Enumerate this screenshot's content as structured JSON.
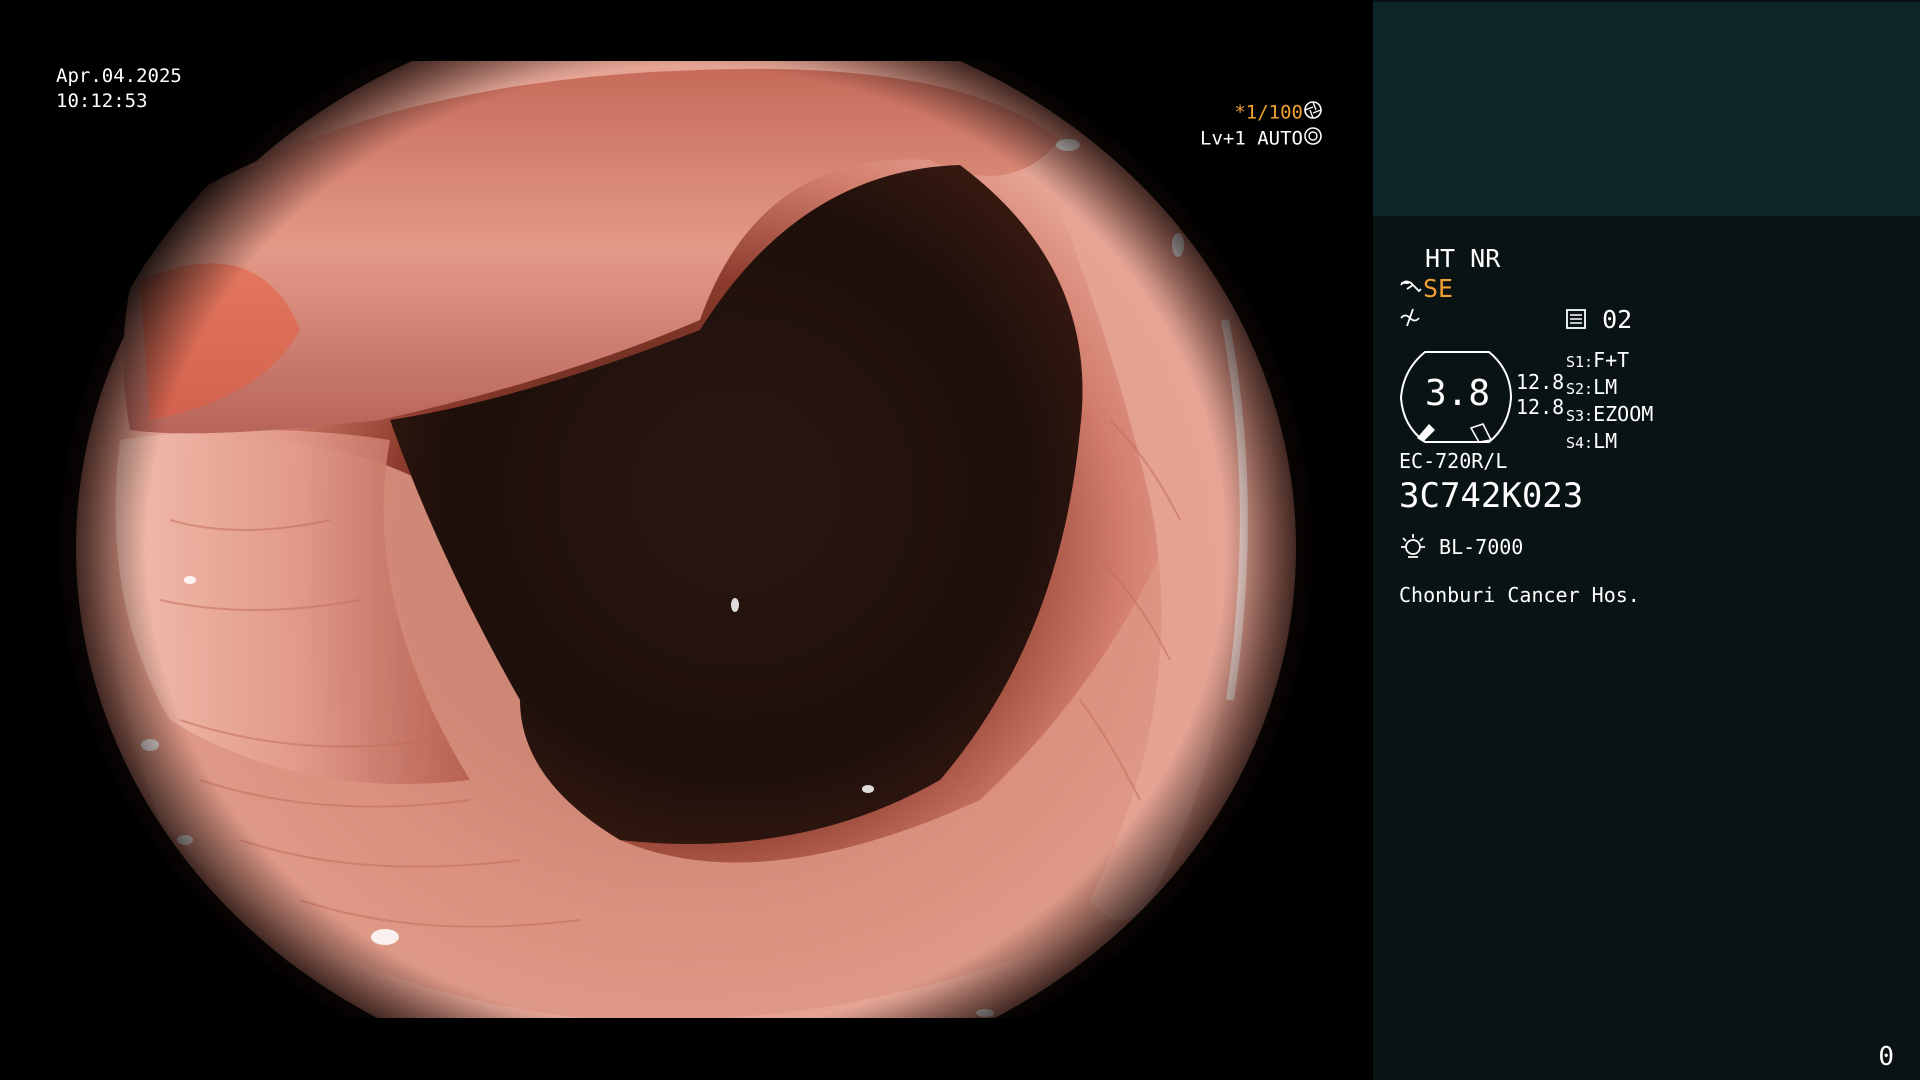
{
  "image": {
    "date": "Apr.04.2025",
    "time": "10:12:53",
    "shutter_speed": "*1/100",
    "shutter_icon": "aperture-icon",
    "exposure": "Lv+1 AUTO",
    "exposure_icon": "iris-icon"
  },
  "panel": {
    "settings_line": "HT NR",
    "structure_enhancement": "SE",
    "structure_icon": "enhancement-icon",
    "color_icon": "color-enhancement-icon",
    "memory_icon": "memory-card-icon",
    "memory_slot": "02",
    "gauge_value": "3.8",
    "mm_values": [
      "12.8",
      "12.8"
    ],
    "switches": [
      {
        "key": "S1:",
        "value": "F+T"
      },
      {
        "key": "S2:",
        "value": "LM"
      },
      {
        "key": "S3:",
        "value": "EZOOM"
      },
      {
        "key": "S4:",
        "value": "LM"
      }
    ],
    "scope_model": "EC-720R/L",
    "scope_serial": "3C742K023",
    "light_icon": "light-source-icon",
    "light_source": "BL-7000",
    "hospital": "Chonburi Cancer Hos.",
    "frame_counter": "0"
  },
  "colors": {
    "panel_bg": "#091314",
    "panel_top_bg": "#0c2528",
    "highlight": "#f0a030",
    "text": "#ffffff"
  }
}
